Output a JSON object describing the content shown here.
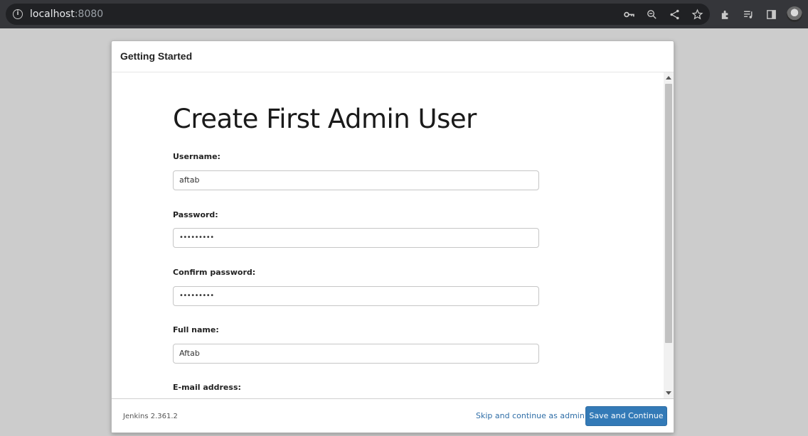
{
  "browser": {
    "url_host": "localhost",
    "url_port": ":8080",
    "icons": [
      "info-icon",
      "key-icon",
      "zoom-icon",
      "share-icon",
      "star-icon",
      "extensions-icon",
      "media-icon",
      "side-panel-icon",
      "profile-avatar"
    ]
  },
  "dialog": {
    "title": "Getting Started",
    "heading": "Create First Admin User",
    "fields": [
      {
        "label": "Username:",
        "value": "aftab",
        "type": "text"
      },
      {
        "label": "Password:",
        "value": "•••••••••",
        "type": "password"
      },
      {
        "label": "Confirm password:",
        "value": "•••••••••",
        "type": "password"
      },
      {
        "label": "Full name:",
        "value": "Aftab",
        "type": "text"
      },
      {
        "label": "E-mail address:",
        "value": "",
        "type": "text"
      }
    ]
  },
  "footer": {
    "version": "Jenkins 2.361.2",
    "skip_label": "Skip and continue as admin",
    "save_label": "Save and Continue"
  },
  "colors": {
    "primary_button": "#337ab7",
    "link": "#2f6ea7",
    "page_background": "#cccccc",
    "browser_bar": "#35363a"
  }
}
